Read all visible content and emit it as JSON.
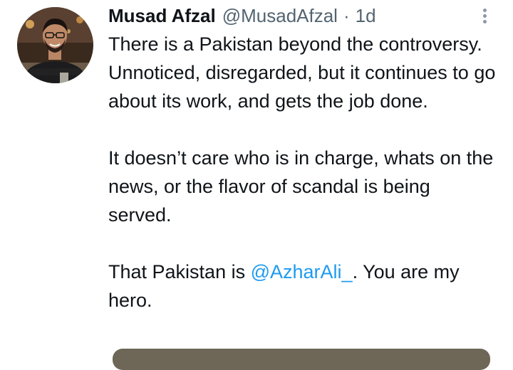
{
  "author": {
    "display_name": "Musad Afzal",
    "handle": "@MusadAfzal",
    "separator": "·",
    "timestamp": "1d"
  },
  "tweet": {
    "paragraph1": "There is a Pakistan beyond the controversy. Unnoticed, disregarded, but it continues to go about its work, and gets the job done.",
    "paragraph2": "It doesn’t care who is in charge, whats on the news, or the flavor of scandal is being served.",
    "paragraph3_prefix": "That Pakistan is ",
    "mention": "@AzharAli_",
    "paragraph3_suffix": ". You are my hero."
  },
  "icons": {
    "avatar": "profile-photo",
    "more": "more-vertical-icon"
  },
  "colors": {
    "link": "#1d9bf0",
    "secondary_text": "#536471",
    "primary_text": "#0f1419"
  }
}
